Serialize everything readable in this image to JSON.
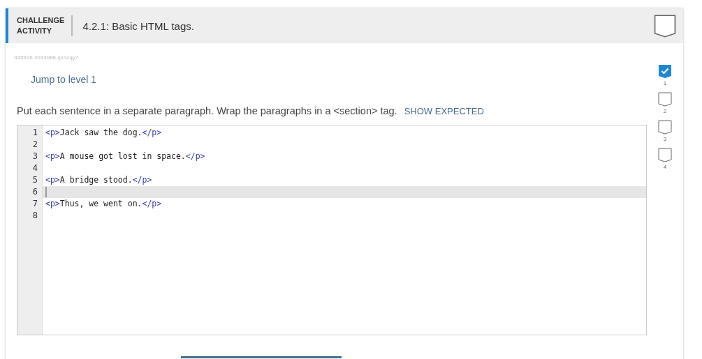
{
  "header": {
    "badge_line_1": "CHALLENGE",
    "badge_line_2": "ACTIVITY",
    "title": "4.2.1: Basic HTML tags."
  },
  "activity_id": "345926.2043986.qx3zqy7",
  "jump_link": "Jump to level 1",
  "instructions": "Put each sentence in a separate paragraph. Wrap the paragraphs in a <section> tag.",
  "show_expected": "SHOW EXPECTED",
  "editor": {
    "lines": [
      {
        "number": "1",
        "active": false,
        "segments": [
          {
            "kind": "tag",
            "text": "<p>"
          },
          {
            "kind": "text",
            "text": "Jack saw the dog."
          },
          {
            "kind": "tag",
            "text": "</p>"
          }
        ]
      },
      {
        "number": "2",
        "active": false
      },
      {
        "number": "3",
        "active": false,
        "segments": [
          {
            "kind": "tag",
            "text": "<p>"
          },
          {
            "kind": "text",
            "text": "A mouse got lost in space."
          },
          {
            "kind": "tag",
            "text": "</p>"
          }
        ]
      },
      {
        "number": "4",
        "active": false
      },
      {
        "number": "5",
        "active": false,
        "segments": [
          {
            "kind": "tag",
            "text": "<p>"
          },
          {
            "kind": "text",
            "text": "A bridge stood."
          },
          {
            "kind": "tag",
            "text": "</p>"
          }
        ]
      },
      {
        "number": "6",
        "active": true
      },
      {
        "number": "7",
        "active": false,
        "segments": [
          {
            "kind": "tag",
            "text": "<p>"
          },
          {
            "kind": "text",
            "text": "Thus, we went on."
          },
          {
            "kind": "tag",
            "text": "</p>"
          }
        ]
      },
      {
        "number": "8",
        "active": false
      }
    ]
  },
  "levels": [
    {
      "label": "1",
      "checked": true
    },
    {
      "label": "2",
      "checked": false
    },
    {
      "label": "3",
      "checked": false
    },
    {
      "label": "4",
      "checked": false
    }
  ]
}
